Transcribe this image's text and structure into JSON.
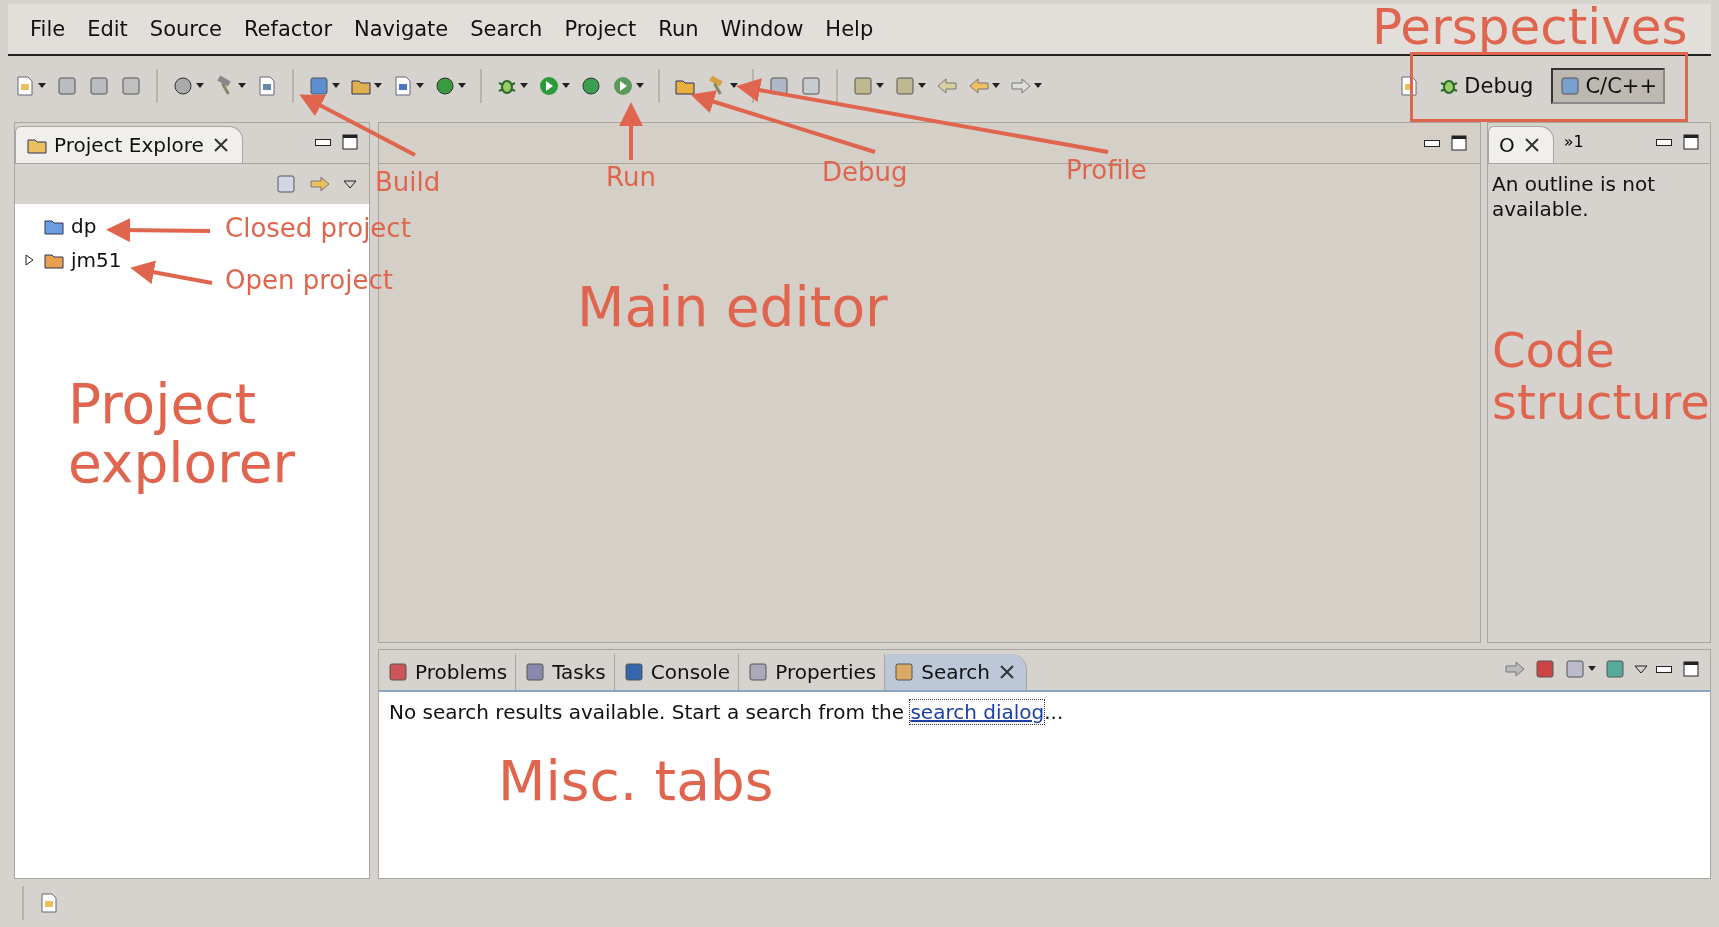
{
  "menu": [
    {
      "label": "File"
    },
    {
      "label": "Edit"
    },
    {
      "label": "Source"
    },
    {
      "label": "Refactor"
    },
    {
      "label": "Navigate"
    },
    {
      "label": "Search"
    },
    {
      "label": "Project"
    },
    {
      "label": "Run"
    },
    {
      "label": "Window"
    },
    {
      "label": "Help"
    }
  ],
  "perspectives": [
    {
      "label": "Debug",
      "selected": false
    },
    {
      "label": "C/C++",
      "selected": true
    }
  ],
  "project_explorer": {
    "tab": "Project Explore",
    "items": [
      {
        "label": "dp",
        "kind": "closed"
      },
      {
        "label": "jm51",
        "kind": "open",
        "expanded": false
      }
    ]
  },
  "outline": {
    "tab": "O",
    "overflow": "»1",
    "message": "An outline is not available."
  },
  "bottom_tabs": [
    {
      "label": "Problems",
      "selected": false
    },
    {
      "label": "Tasks",
      "selected": false
    },
    {
      "label": "Console",
      "selected": false
    },
    {
      "label": "Properties",
      "selected": false
    },
    {
      "label": "Search",
      "selected": true
    }
  ],
  "search_view": {
    "message": "No search results available. Start a search from the ",
    "link": "search dialog",
    "suffix": "..."
  },
  "annotations": [
    {
      "text": "Perspectives"
    },
    {
      "text": "Build"
    },
    {
      "text": "Run"
    },
    {
      "text": "Debug"
    },
    {
      "text": "Profile"
    },
    {
      "text": "Closed project"
    },
    {
      "text": "Open project"
    },
    {
      "text": "Main editor"
    },
    {
      "text": "Project explorer"
    },
    {
      "text": "Code structure"
    },
    {
      "text": "Misc. tabs"
    }
  ]
}
